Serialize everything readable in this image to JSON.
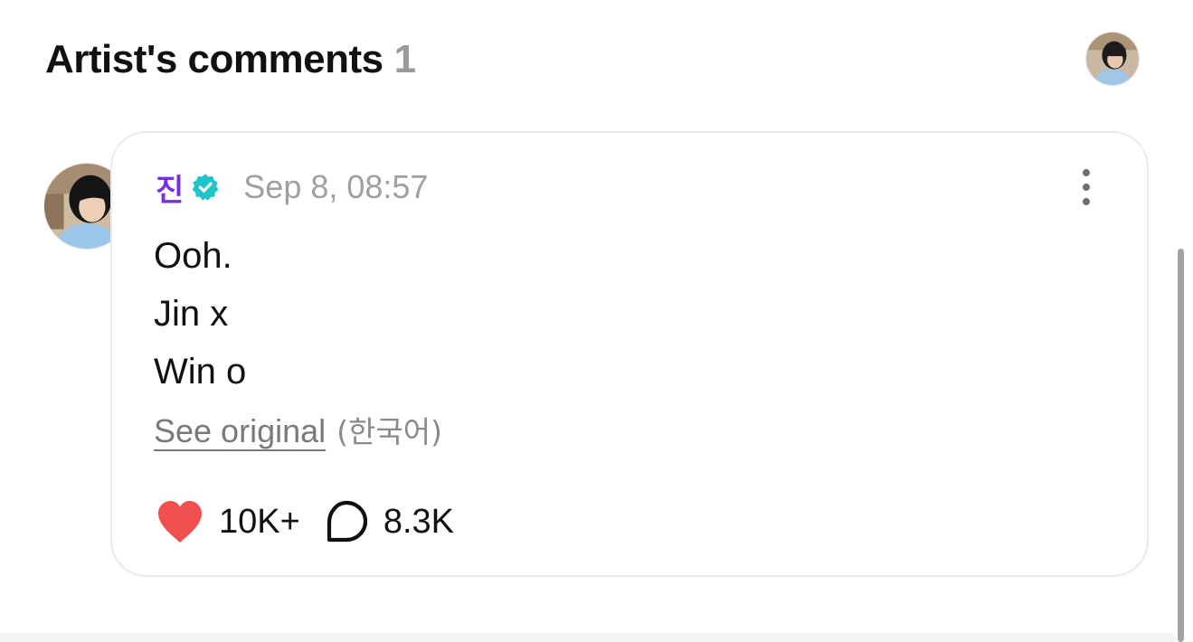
{
  "header": {
    "title": "Artist's comments",
    "count": "1"
  },
  "comment": {
    "author": "진",
    "verified": true,
    "timestamp": "Sep 8, 08:57",
    "lines": [
      "Ooh.",
      "Jin x",
      "Win o"
    ],
    "see_original_label": "See original",
    "original_language": "(한국어)",
    "likes": "10K+",
    "replies": "8.3K"
  },
  "icons": {
    "verified": "verified-badge-icon",
    "more": "more-vertical-icon",
    "like": "heart-icon",
    "reply": "speech-bubble-icon"
  },
  "colors": {
    "author_name": "#7a2ee3",
    "verified_badge": "#1fc5c9",
    "heart": "#f2504f",
    "timestamp": "#a0a0a0",
    "card_border": "#e9eaee"
  }
}
